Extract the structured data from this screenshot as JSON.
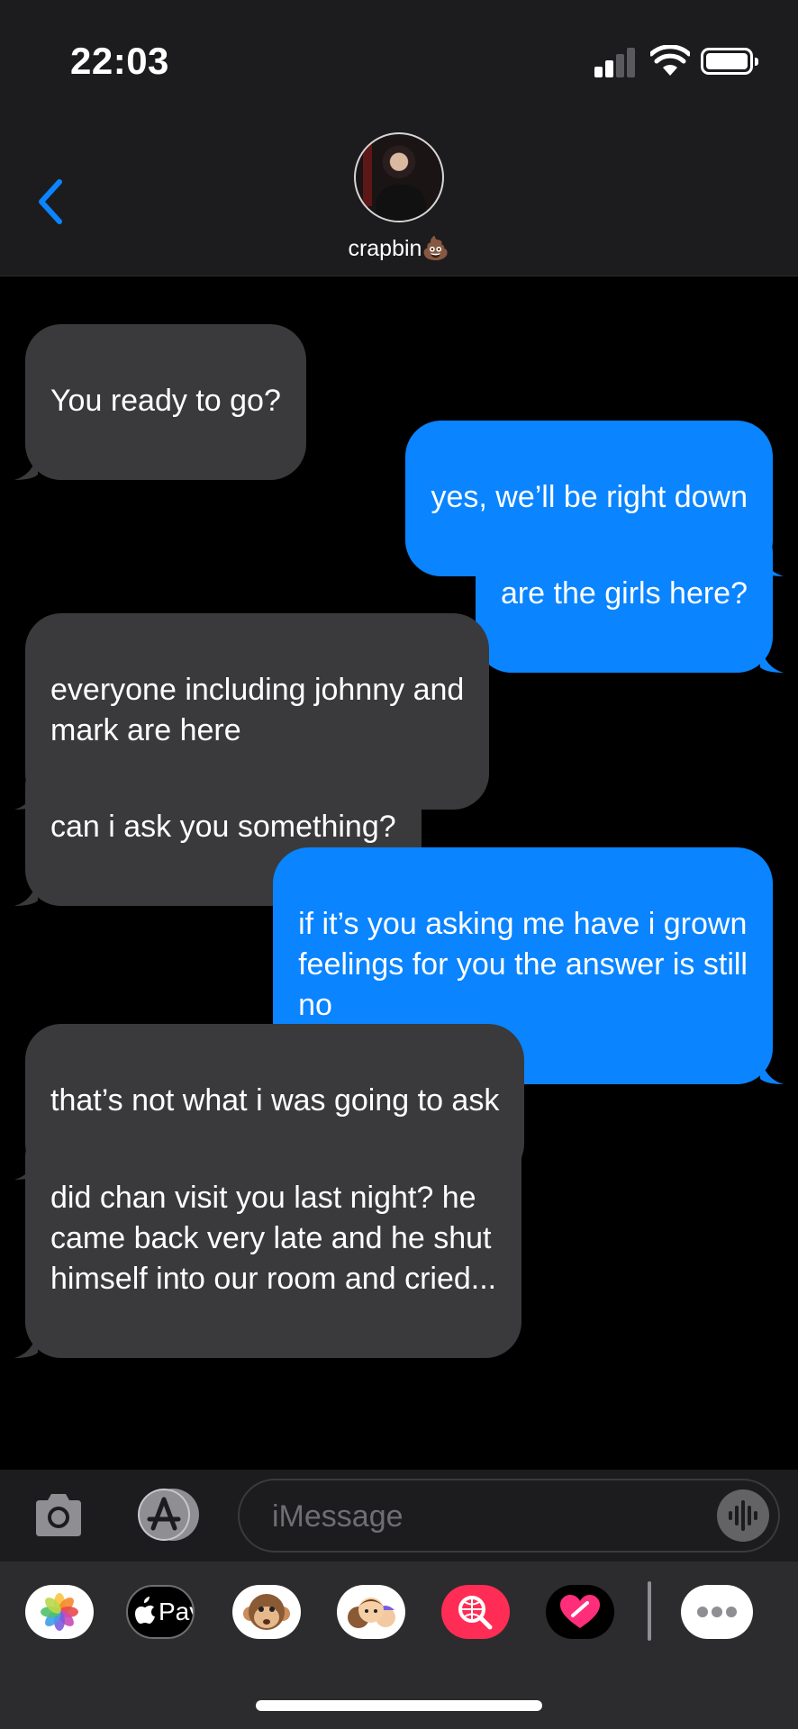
{
  "status_bar": {
    "time": "22:03",
    "icons": [
      "cellular-signal-icon",
      "wifi-icon",
      "battery-icon"
    ]
  },
  "header": {
    "back_icon": "chevron-left-icon",
    "contact_name": "crapbin💩",
    "accent_color": "#0a84ff"
  },
  "messages": [
    {
      "direction": "incoming",
      "text": "You ready to go?"
    },
    {
      "direction": "outgoing",
      "text": "yes, we’ll be right down"
    },
    {
      "direction": "outgoing",
      "text": "are the girls here?"
    },
    {
      "direction": "incoming",
      "text": "everyone including johnny and\nmark are here"
    },
    {
      "direction": "incoming",
      "text": "can i ask you something?"
    },
    {
      "direction": "outgoing",
      "text": "if it’s you asking me have i grown\nfeelings for you the answer is still\nno"
    },
    {
      "direction": "incoming",
      "text": "that’s not what i was going to ask"
    },
    {
      "direction": "incoming",
      "text": "did chan visit you last night? he\ncame back very late and he shut\nhimself into our room and cried..."
    }
  ],
  "input_bar": {
    "placeholder": "iMessage",
    "camera_icon": "camera-icon",
    "appstore_icon": "app-store-icon",
    "audio_icon": "audio-waveform-icon"
  },
  "app_drawer": {
    "apps": [
      {
        "name": "photos-app-icon"
      },
      {
        "name": "apple-pay-app-icon",
        "label": "Pay"
      },
      {
        "name": "animoji-app-icon"
      },
      {
        "name": "memoji-app-icon"
      },
      {
        "name": "web-search-app-icon"
      },
      {
        "name": "digital-touch-app-icon"
      },
      {
        "name": "more-apps-icon"
      }
    ]
  },
  "colors": {
    "incoming_bubble": "#3a3a3c",
    "outgoing_bubble": "#0a84ff",
    "background": "#000000",
    "bar_background": "#1c1c1e"
  }
}
